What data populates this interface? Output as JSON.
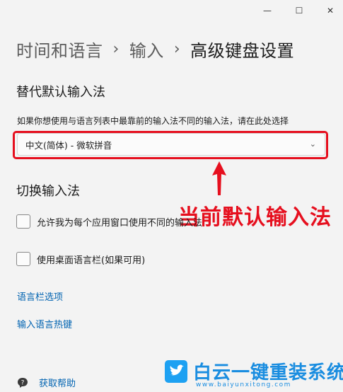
{
  "window": {
    "minimize_icon": "—",
    "maximize_icon": "☐",
    "close_icon": "✕"
  },
  "breadcrumb": {
    "parent": "时间和语言",
    "separator": "›",
    "middle": "输入",
    "current": "高级键盘设置"
  },
  "override_section": {
    "title": "替代默认输入法",
    "description": "如果你想使用与语言列表中最靠前的输入法不同的输入法，请在此处选择",
    "selected_value": "中文(简体) - 微软拼音",
    "chevron": "⌄"
  },
  "annotation": {
    "text": "当前默认输入法",
    "color": "#e60f1e"
  },
  "switch_section": {
    "title": "切换输入法",
    "options": [
      {
        "label": "允许我为每个应用窗口使用不同的输入法",
        "checked": false
      },
      {
        "label": "使用桌面语言栏(如果可用)",
        "checked": false
      }
    ]
  },
  "links": {
    "language_bar_options": "语言栏选项",
    "input_language_hotkeys": "输入语言热键"
  },
  "help": {
    "label": "获取帮助",
    "icon": "help-icon"
  },
  "watermark": {
    "brand": "白云一键重装系统",
    "url": "www.baiyunxitong.com"
  },
  "colors": {
    "background": "#f3f3f3",
    "accent_link": "#0063b1",
    "highlight_red": "#e60f1e"
  }
}
